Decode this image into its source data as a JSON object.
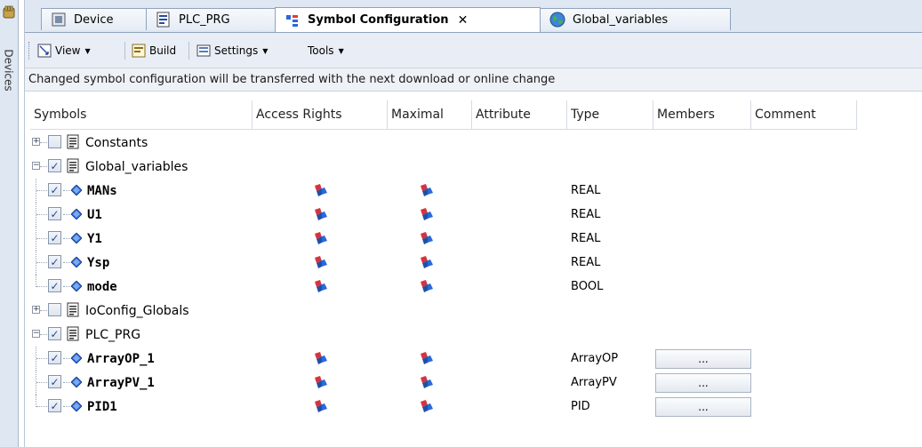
{
  "strip": {
    "label": "Devices",
    "tool_icon": "hand-tool-icon"
  },
  "tabs": [
    {
      "label": "Device",
      "icon": "device-icon",
      "active": false
    },
    {
      "label": "PLC_PRG",
      "icon": "pou-icon",
      "active": false
    },
    {
      "label": "Symbol Configuration",
      "icon": "symbol-config-icon",
      "active": true,
      "close": "✕"
    },
    {
      "label": "Global_variables",
      "icon": "globe-icon",
      "active": false
    }
  ],
  "toolbar": {
    "view_label": "View",
    "build_label": "Build",
    "settings_label": "Settings",
    "tools_label": "Tools"
  },
  "info_message": "Changed symbol configuration will be transferred with the next download or online change",
  "columns": [
    "Symbols",
    "Access Rights",
    "Maximal",
    "Attribute",
    "Type",
    "Members",
    "Comment"
  ],
  "rows": [
    {
      "kind": "group",
      "name": "Constants",
      "expanded": false,
      "checked": false
    },
    {
      "kind": "group",
      "name": "Global_variables",
      "expanded": true,
      "checked": true
    },
    {
      "kind": "var",
      "name": "MANs",
      "checked": true,
      "type": "REAL",
      "members": ""
    },
    {
      "kind": "var",
      "name": "U1",
      "checked": true,
      "type": "REAL",
      "members": ""
    },
    {
      "kind": "var",
      "name": "Y1",
      "checked": true,
      "type": "REAL",
      "members": ""
    },
    {
      "kind": "var",
      "name": "Ysp",
      "checked": true,
      "type": "REAL",
      "members": ""
    },
    {
      "kind": "var",
      "name": "mode",
      "checked": true,
      "type": "BOOL",
      "members": "",
      "last": true
    },
    {
      "kind": "group",
      "name": "IoConfig_Globals",
      "expanded": false,
      "checked": false
    },
    {
      "kind": "group",
      "name": "PLC_PRG",
      "expanded": true,
      "checked": true
    },
    {
      "kind": "var",
      "name": "ArrayOP_1",
      "checked": true,
      "type": "ArrayOP",
      "members": "..."
    },
    {
      "kind": "var",
      "name": "ArrayPV_1",
      "checked": true,
      "type": "ArrayPV",
      "members": "..."
    },
    {
      "kind": "var",
      "name": "PID1",
      "checked": true,
      "type": "PID",
      "members": "...",
      "last": true
    }
  ],
  "colors": {
    "accent": "#2a4aa0",
    "panel": "#dfe7f3",
    "border": "#8fa3bd"
  }
}
